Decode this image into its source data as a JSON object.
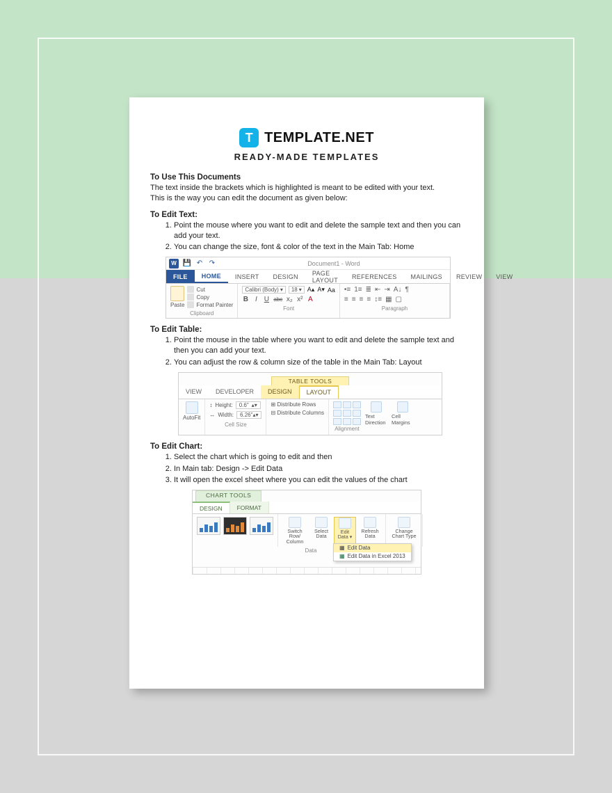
{
  "brand": {
    "icon_letter": "T",
    "name": "TEMPLATE.NET",
    "subtitle": "READY-MADE TEMPLATES"
  },
  "intro": {
    "heading": "To Use This Documents",
    "line1": "The text inside the brackets which is highlighted is meant to be edited with your text.",
    "line2": "This is the way you can edit the document as given below:"
  },
  "edit_text": {
    "heading": "To Edit Text:",
    "steps": [
      "Point the mouse where you want to edit and delete the sample text and then you can add your text.",
      "You can change the size, font & color of the text in the Main Tab: Home"
    ]
  },
  "ribbon1": {
    "doc_title": "Document1 - Word",
    "tabs": {
      "file": "FILE",
      "home": "HOME",
      "insert": "INSERT",
      "design": "DESIGN",
      "page_layout": "PAGE LAYOUT",
      "references": "REFERENCES",
      "mailings": "MAILINGS",
      "review": "REVIEW",
      "view": "VIEW"
    },
    "clipboard": {
      "paste": "Paste",
      "cut": "Cut",
      "copy": "Copy",
      "format_painter": "Format Painter",
      "label": "Clipboard"
    },
    "font": {
      "name": "Calibri (Body)",
      "size": "18",
      "label": "Font",
      "bold": "B",
      "italic": "I",
      "underline": "U",
      "strike": "abc",
      "sub": "x₂",
      "sup": "x²"
    },
    "paragraph": {
      "label": "Paragraph"
    }
  },
  "edit_table": {
    "heading": "To Edit Table:",
    "steps": [
      "Point the mouse in the table where you want to edit and delete the sample text and then you can add your text.",
      "You can adjust the row & column size of the table in the Main Tab: Layout"
    ]
  },
  "ribbon2": {
    "table_tools": "TABLE TOOLS",
    "tabs": {
      "view": "VIEW",
      "developer": "DEVELOPER",
      "design": "DESIGN",
      "layout": "LAYOUT"
    },
    "autofit": "AutoFit",
    "height_lbl": "Height:",
    "height_val": "0.6\"",
    "width_lbl": "Width:",
    "width_val": "6.26\"",
    "dist_rows": "Distribute Rows",
    "dist_cols": "Distribute Columns",
    "cell_size": "Cell Size",
    "text_dir": "Text Direction",
    "cell_margins": "Cell Margins",
    "alignment": "Alignment"
  },
  "edit_chart": {
    "heading": "To Edit Chart:",
    "steps": [
      "Select the chart which is going to edit and then",
      "In Main tab: Design -> Edit Data",
      "It will open the excel sheet where you can edit the values of the chart"
    ]
  },
  "ribbon3": {
    "chart_tools": "CHART TOOLS",
    "tabs": {
      "design": "DESIGN",
      "format": "FORMAT"
    },
    "switch": "Switch Row/\nColumn",
    "select_data": "Select Data",
    "edit_data": "Edit Data",
    "refresh": "Refresh Data",
    "change_type": "Change Chart Type",
    "data_lbl": "Data",
    "menu": {
      "edit_data": "Edit Data",
      "edit_excel": "Edit Data in Excel 2013"
    }
  }
}
